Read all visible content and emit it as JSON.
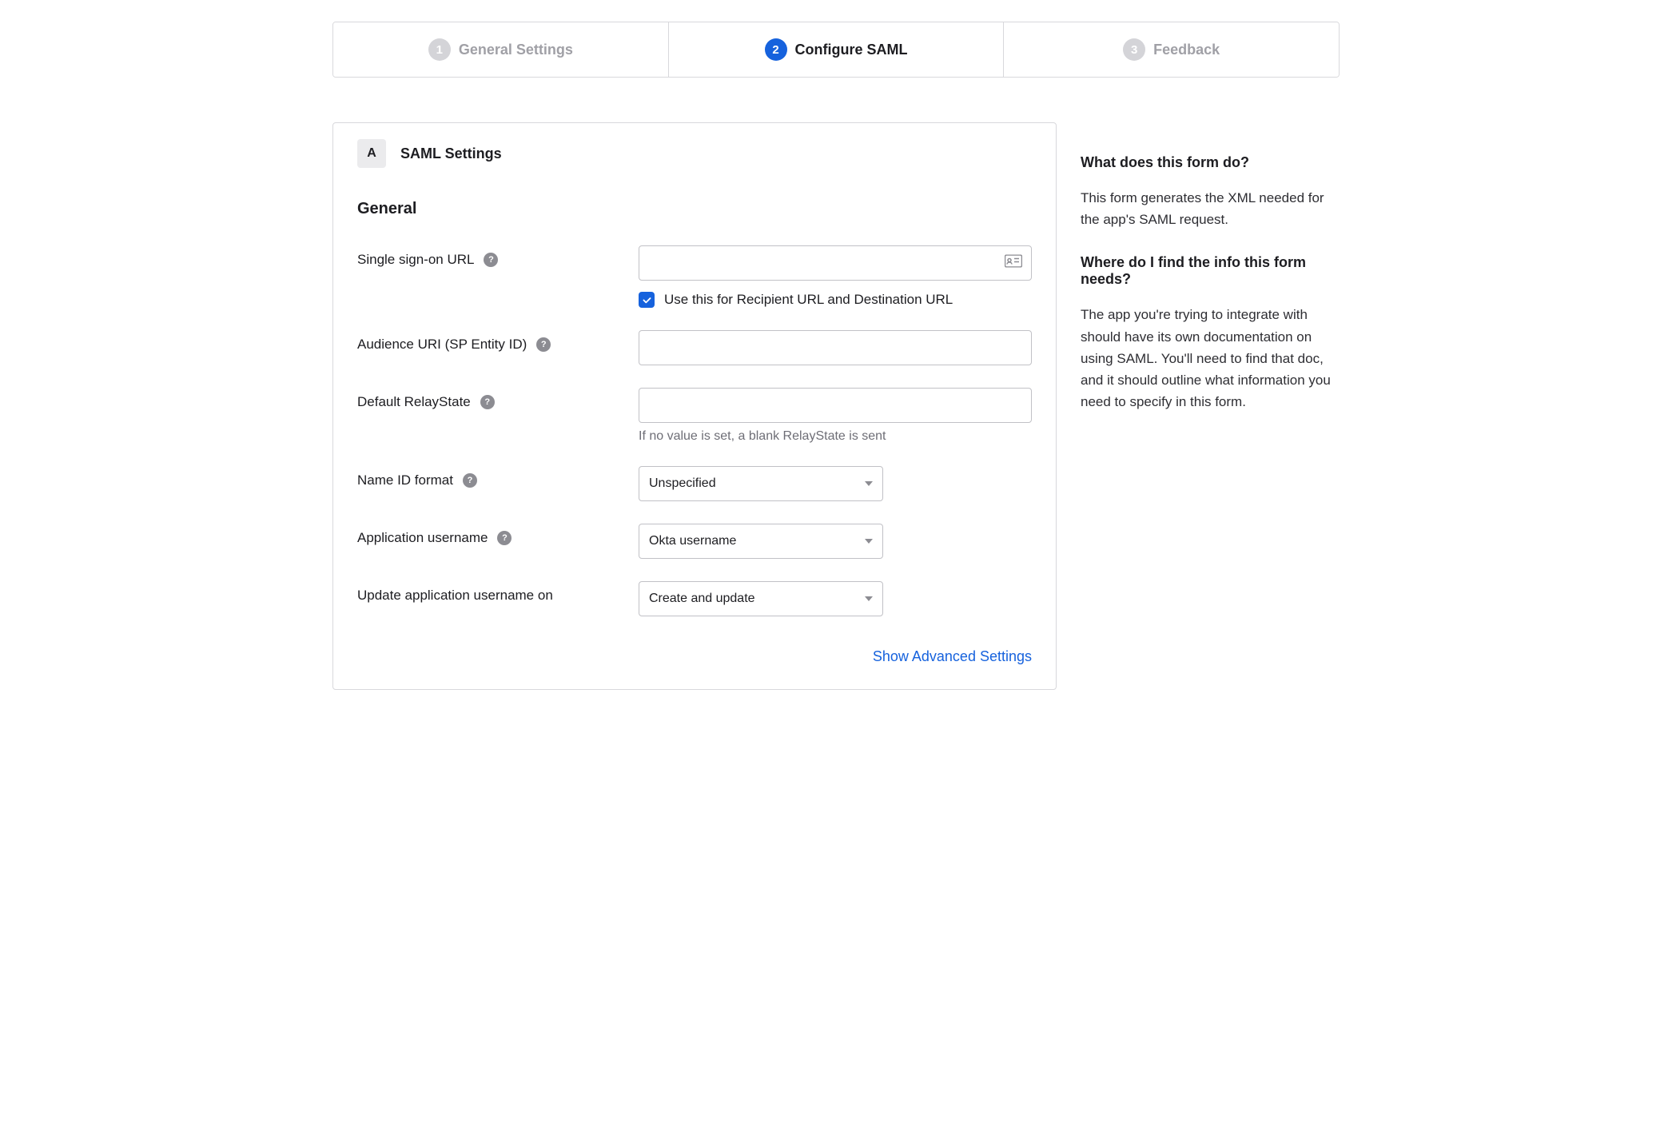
{
  "tabs": [
    {
      "num": "1",
      "label": "General Settings"
    },
    {
      "num": "2",
      "label": "Configure SAML"
    },
    {
      "num": "3",
      "label": "Feedback"
    }
  ],
  "active_tab_index": 1,
  "section": {
    "letter": "A",
    "title": "SAML Settings",
    "subsection": "General"
  },
  "fields": {
    "sso_url": {
      "label": "Single sign-on URL",
      "value": "",
      "checkbox_label": "Use this for Recipient URL and Destination URL",
      "checked": true
    },
    "audience_uri": {
      "label": "Audience URI (SP Entity ID)",
      "value": ""
    },
    "relay_state": {
      "label": "Default RelayState",
      "value": "",
      "hint": "If no value is set, a blank RelayState is sent"
    },
    "name_id": {
      "label": "Name ID format",
      "value": "Unspecified"
    },
    "app_username": {
      "label": "Application username",
      "value": "Okta username"
    },
    "update_on": {
      "label": "Update application username on",
      "value": "Create and update"
    }
  },
  "advanced_link": "Show Advanced Settings",
  "aside": {
    "h1": "What does this form do?",
    "p1": "This form generates the XML needed for the app's SAML request.",
    "h2": "Where do I find the info this form needs?",
    "p2": "The app you're trying to integrate with should have its own documentation on using SAML. You'll need to find that doc, and it should outline what information you need to specify in this form."
  }
}
